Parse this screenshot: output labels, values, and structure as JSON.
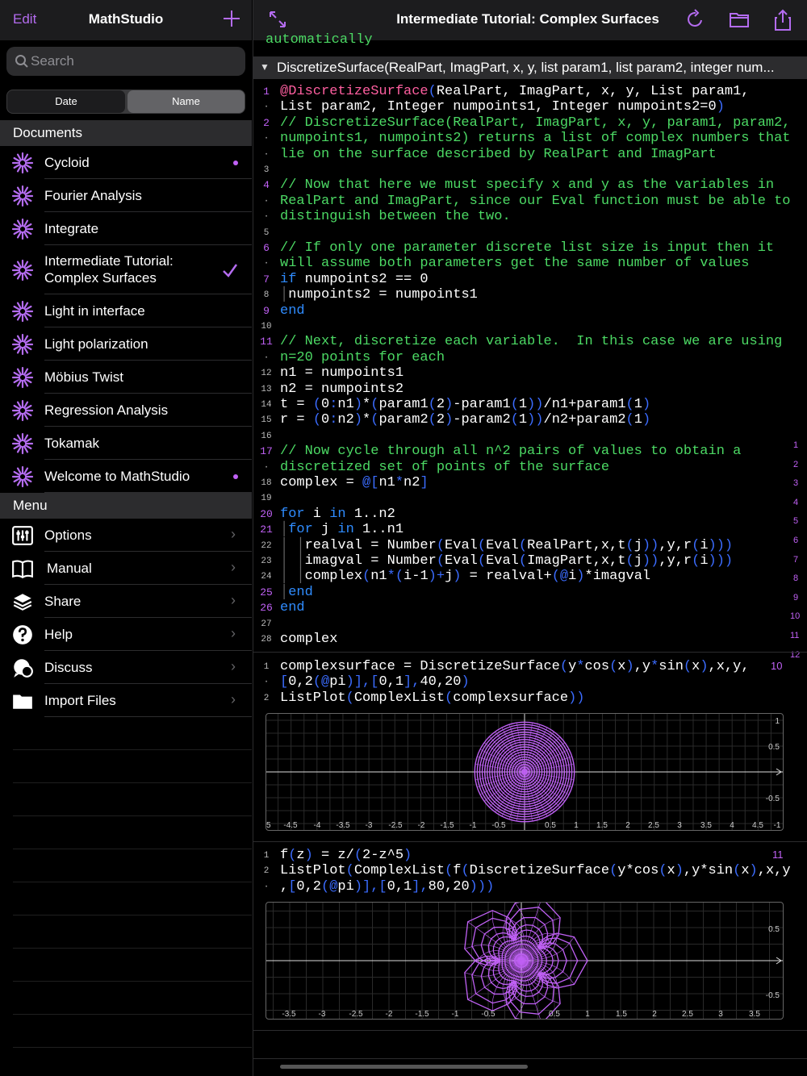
{
  "sidebar": {
    "edit_label": "Edit",
    "app_title": "MathStudio",
    "search_placeholder": "Search",
    "sort_tabs": [
      "Date",
      "Name"
    ],
    "sort_selected": "Name",
    "documents_header": "Documents",
    "documents": [
      {
        "label": "Cycloid",
        "badge": "dot"
      },
      {
        "label": "Fourier Analysis"
      },
      {
        "label": "Integrate"
      },
      {
        "label": "Intermediate Tutorial: Complex Surfaces",
        "line1": "Intermediate Tutorial:",
        "line2": "Complex Surfaces",
        "selected": true
      },
      {
        "label": "Light in interface"
      },
      {
        "label": "Light polarization"
      },
      {
        "label": "Möbius Twist"
      },
      {
        "label": "Regression Analysis"
      },
      {
        "label": "Tokamak"
      },
      {
        "label": "Welcome to MathStudio",
        "badge": "dot"
      }
    ],
    "menu_header": "Menu",
    "menu": [
      {
        "label": "Options",
        "icon": "sliders-icon"
      },
      {
        "label": "Manual",
        "icon": "book-icon"
      },
      {
        "label": "Share",
        "icon": "share-stack-icon"
      },
      {
        "label": "Help",
        "icon": "question-icon"
      },
      {
        "label": "Discuss",
        "icon": "discuss-icon"
      },
      {
        "label": "Import Files",
        "icon": "folder-icon"
      }
    ]
  },
  "main": {
    "title": "Intermediate Tutorial: Complex Surfaces",
    "truncated_top_line": "automatically",
    "section_title": "DiscretizeSurface(RealPart, ImagPart, x, y, list param1, list param2, integer num...",
    "output_numbers": [
      "1",
      "2",
      "3",
      "4",
      "5",
      "6",
      "7",
      "8",
      "9",
      "10",
      "11",
      "12"
    ],
    "cell1_number": "10",
    "cell2_number": "11"
  },
  "colors": {
    "accent": "#b46cf0",
    "comment": "#4cd964",
    "keyword": "#2f8cff",
    "plot_curve": "#c061f5"
  },
  "plot1": {
    "x_ticks": [
      "5",
      "-4.5",
      "-4",
      "-3.5",
      "-3",
      "-2.5",
      "-2",
      "-1.5",
      "-1",
      "-0.5",
      "0.5",
      "1",
      "1.5",
      "2",
      "2.5",
      "3",
      "3.5",
      "4",
      "4.5",
      "-1"
    ],
    "y_ticks": [
      "1",
      "0.5",
      "-0.5"
    ]
  },
  "plot2": {
    "x_ticks": [
      "-3.5",
      "-3",
      "-2.5",
      "-2",
      "-1.5",
      "-1",
      "-0.5",
      "0.5",
      "1",
      "1.5",
      "2",
      "2.5",
      "3",
      "3.5"
    ],
    "y_ticks": [
      "0.5",
      "-0.5"
    ]
  }
}
